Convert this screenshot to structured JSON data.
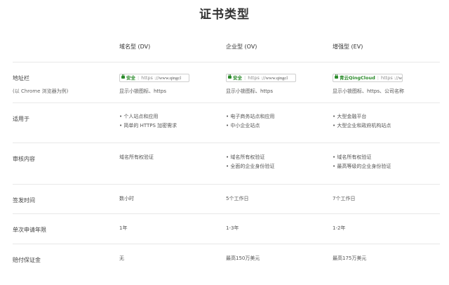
{
  "title": "证书类型",
  "columns": [
    "域名型 (DV)",
    "企业型 (OV)",
    "增强型 (EV)"
  ],
  "address_row": {
    "label": "地址栏",
    "sublabel": "(以 Chrome 浏览器为例)",
    "bars": [
      {
        "badge": "安全",
        "url_prefix": "https ://",
        "url": "www.qingcl"
      },
      {
        "badge": "安全",
        "url_prefix": "https ://",
        "url": "www.qingcl"
      },
      {
        "badge": "青云QingCloud",
        "url_prefix": "https ://",
        "url": "w"
      }
    ],
    "captions": [
      "显示小锁图标、https",
      "显示小锁图标、https",
      "显示小锁图标、https、公司名称"
    ]
  },
  "rows": [
    {
      "label": "适用于",
      "cells": [
        [
          "• 个人站点和应用",
          "• 简单的 HTTPS 加密需求"
        ],
        [
          "• 电子商务站点和应用",
          "• 中小企业站点"
        ],
        [
          "• 大型金融平台",
          "• 大型企业和政府机构站点"
        ]
      ]
    },
    {
      "label": "审核内容",
      "cells": [
        [
          "域名所有权验证"
        ],
        [
          "• 域名所有权验证",
          "• 全面的企业身份验证"
        ],
        [
          "• 域名所有权验证",
          "• 最高等级的企业身份验证"
        ]
      ]
    },
    {
      "label": "签发时间",
      "cells": [
        [
          "数小时"
        ],
        [
          "5个工作日"
        ],
        [
          "7个工作日"
        ]
      ]
    },
    {
      "label": "单次申请年限",
      "cells": [
        [
          "1年"
        ],
        [
          "1-3年"
        ],
        [
          "1-2年"
        ]
      ]
    },
    {
      "label": "赔付保证金",
      "cells": [
        [
          "无"
        ],
        [
          "最高150万美元"
        ],
        [
          "最高175万美元"
        ]
      ]
    }
  ],
  "colors": {
    "secure_green": "#2a8a2a",
    "divider": "#e8e8e8"
  }
}
